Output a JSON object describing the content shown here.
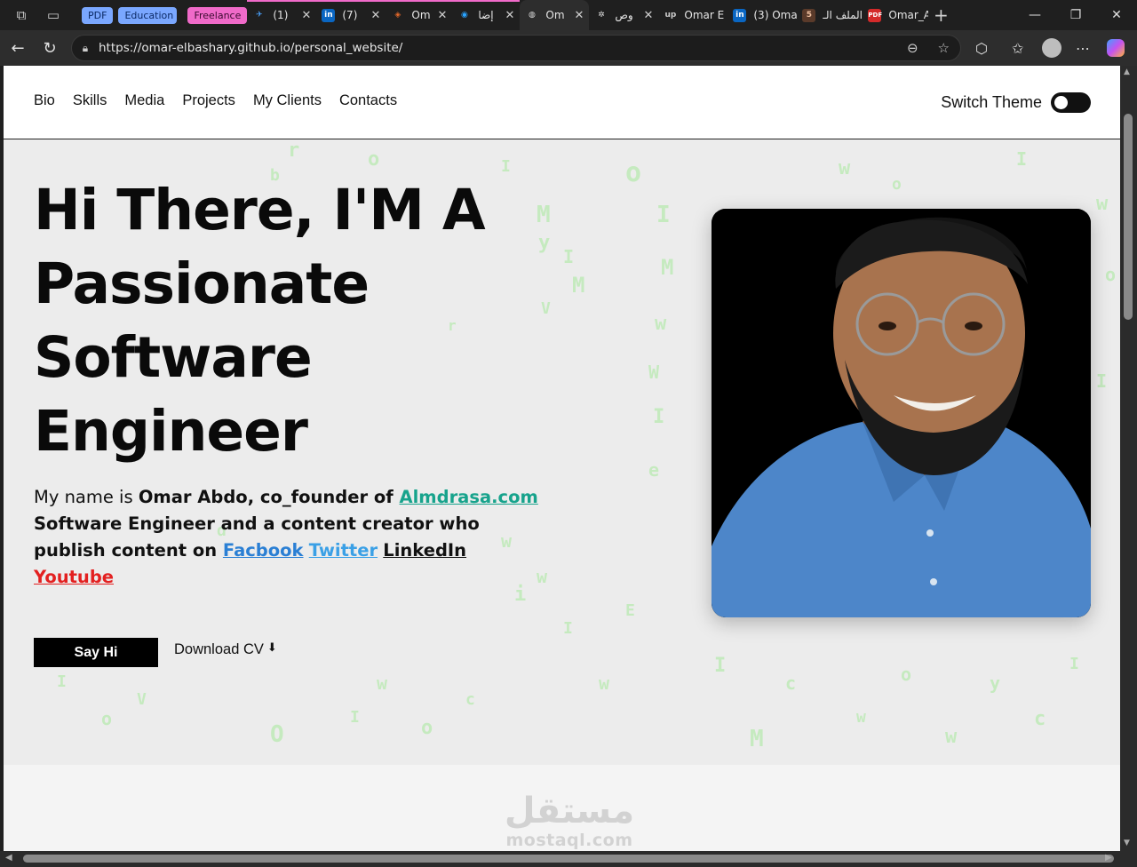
{
  "browser": {
    "tab_groups": [
      "PDF",
      "Education",
      "Freelance"
    ],
    "tabs": [
      {
        "label": "(1)",
        "favicon": "twitter-x-icon"
      },
      {
        "label": "(7)",
        "favicon": "linkedin-icon"
      },
      {
        "label": "Om",
        "favicon": "shield-icon"
      },
      {
        "label": "إضا",
        "favicon": "circle-icon"
      },
      {
        "label": "Om",
        "favicon": "globe-icon",
        "active": true
      },
      {
        "label": "وص",
        "favicon": "openai-icon"
      },
      {
        "label": "Omar E",
        "favicon": "upwork-icon"
      },
      {
        "label": "(3) Oma",
        "favicon": "linkedin-icon"
      },
      {
        "label": "الملف الـ",
        "favicon": "mostaql-icon"
      },
      {
        "label": "Omar_A",
        "favicon": "pdf-icon"
      }
    ],
    "url": "https://omar-elbashary.github.io/personal_website/"
  },
  "nav": {
    "items": [
      "Bio",
      "Skills",
      "Media",
      "Projects",
      "My Clients",
      "Contacts"
    ],
    "switch_label": "Switch Theme"
  },
  "hero": {
    "headline": "Hi There, I'M A Passionate Software Engineer",
    "intro": {
      "prefix": "My name is ",
      "name": "Omar Abdo, co_founder of ",
      "company_link": "Almdrasa.com",
      "middle": "Software Engineer and a content creator who publish content on ",
      "links": [
        "Facbook",
        "Twitter",
        "LinkedIn",
        "Youtube"
      ]
    },
    "cta_primary": "Say Hi",
    "cta_secondary": "Download CV",
    "cta_secondary_arrow": "⬇"
  },
  "watermark": {
    "arabic": "مستقل",
    "latin": "mostaql.com"
  },
  "colors": {
    "link_almdrasa": "#17a38c",
    "link_facebook": "#2a7fd4",
    "link_twitter": "#3aa0e6",
    "link_youtube": "#e32020",
    "matrix_glyph": "#b9eab0"
  }
}
